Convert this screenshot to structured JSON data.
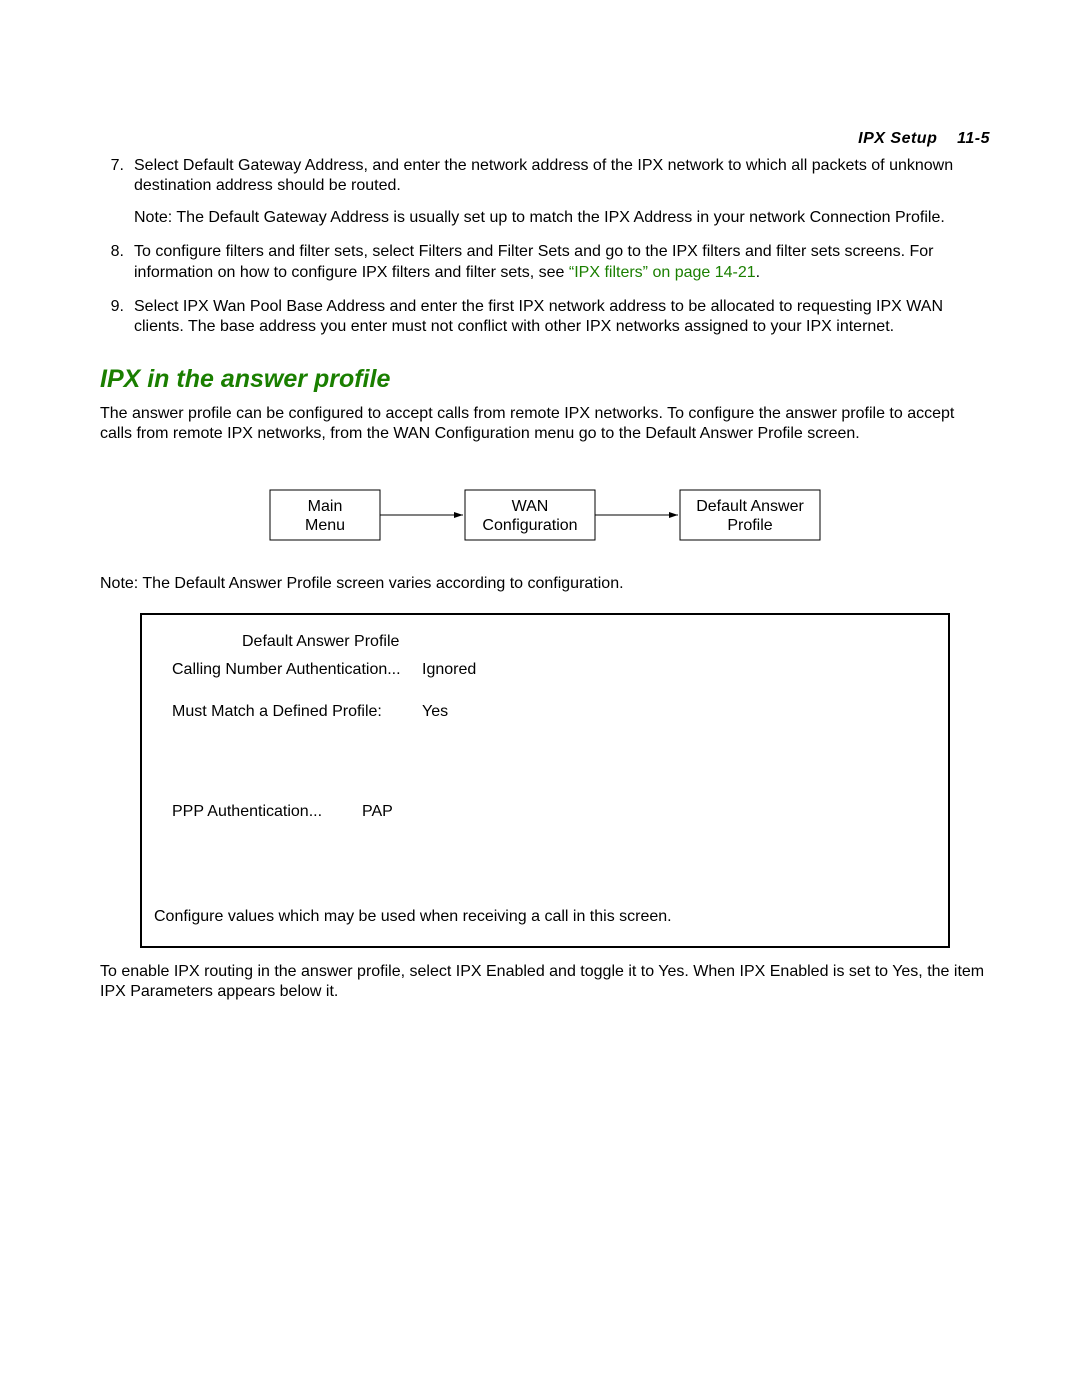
{
  "header": {
    "section": "IPX Setup",
    "page_ref": "11-5"
  },
  "list": {
    "items": [
      {
        "num": "7.",
        "text": "Select Default Gateway Address, and enter the network address of the IPX network to which all packets of unknown destination address should be routed.",
        "note_prefix": "Note:",
        "note_text": " The Default Gateway Address is usually set up to match the IPX Address in your network Connection Profile."
      },
      {
        "num": "8.",
        "text_a": "To configure filters and filter sets, select Filters and Filter Sets and go to the IPX filters and filter sets screens. For information on how to configure IPX filters and filter sets, see ",
        "xref": "“IPX filters” on page 14-21",
        "text_b": "."
      },
      {
        "num": "9.",
        "text": "Select IPX Wan Pool Base Address and enter the first IPX network address to be allocated to requesting IPX WAN clients. The base address you enter must not conflict with other IPX networks assigned to your IPX internet."
      }
    ]
  },
  "section_heading": "IPX in the answer profile",
  "intro_para": "The answer profile can be configured to accept calls from remote IPX networks. To configure the answer profile to accept calls from remote IPX networks, from the WAN Configuration menu go to the Default Answer Profile screen.",
  "flow": {
    "box1_l1": "Main",
    "box1_l2": "Menu",
    "box2_l1": "WAN",
    "box2_l2": "Configuration",
    "box3_l1": "Default Answer",
    "box3_l2": "Profile"
  },
  "note_after_flow_prefix": "Note:",
  "note_after_flow_text": " The Default Answer Profile screen varies according to configuration.",
  "terminal": {
    "title": "Default Answer Profile",
    "row1_label": "Calling Number Authentication...",
    "row1_value": "Ignored",
    "row2_label": "Must Match a Defined Profile:",
    "row2_value": "Yes",
    "row3_label": "PPP Authentication...",
    "row3_value": "PAP",
    "footer": "Configure values which may be used when receiving a call in this screen."
  },
  "closing_para": "To enable IPX routing in the answer profile, select IPX Enabled and toggle it to Yes. When IPX Enabled is set to Yes, the item IPX Parameters appears below it."
}
